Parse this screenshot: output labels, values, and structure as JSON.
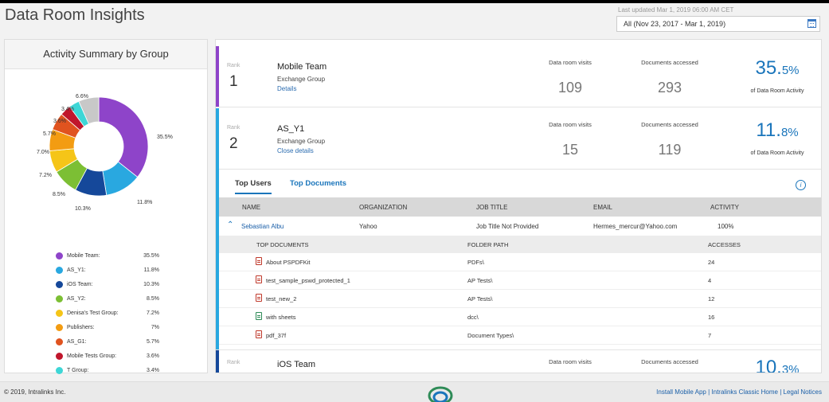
{
  "header": {
    "title": "Data Room Insights",
    "last_updated": "Last updated Mar 1, 2019 06:00 AM CET",
    "date_range": "All (Nov 23, 2017 - Mar 1, 2019)"
  },
  "activity_summary": {
    "title": "Activity Summary by Group",
    "slices": [
      {
        "label": "Mobile Team:",
        "value": "35.5%",
        "pct": 35.5,
        "color": "#8e44c9"
      },
      {
        "label": "AS_Y1:",
        "value": "11.8%",
        "pct": 11.8,
        "color": "#29a8e0"
      },
      {
        "label": "iOS Team:",
        "value": "10.3%",
        "pct": 10.3,
        "color": "#15489a"
      },
      {
        "label": "AS_Y2:",
        "value": "8.5%",
        "pct": 8.5,
        "color": "#7cbf34"
      },
      {
        "label": "Denisa's Test Group:",
        "value": "7.2%",
        "pct": 7.2,
        "color": "#f5c518"
      },
      {
        "label": "Publishers:",
        "value": "7%",
        "pct": 7.0,
        "color": "#f39c12"
      },
      {
        "label": "AS_G1:",
        "value": "5.7%",
        "pct": 5.7,
        "color": "#e0531f"
      },
      {
        "label": "Mobile Tests Group:",
        "value": "3.6%",
        "pct": 3.6,
        "color": "#c0162c"
      },
      {
        "label": "T Group:",
        "value": "3.4%",
        "pct": 3.4,
        "color": "#3ed6d6"
      },
      {
        "label": "",
        "value": "6.6%",
        "pct": 6.6,
        "color": "#c8c8c8"
      }
    ],
    "outer_labels": [
      "35.5%",
      "11.8%",
      "10.3%",
      "8.5%",
      "7.2%",
      "7.0%",
      "5.7%",
      "3.6%",
      "3.4%",
      "6.6%"
    ]
  },
  "cards": [
    {
      "rank_label": "Rank",
      "rank": "1",
      "name": "Mobile Team",
      "sub": "Exchange Group",
      "link": "Details",
      "visits_label": "Data room visits",
      "visits": "109",
      "docs_label": "Documents accessed",
      "docs": "293",
      "pct_main": "35.",
      "pct_small": "5%",
      "pct_label": "of Data Room Activity",
      "stripe": "#8e44c9"
    },
    {
      "rank_label": "Rank",
      "rank": "2",
      "name": "AS_Y1",
      "sub": "Exchange Group",
      "link": "Close details",
      "visits_label": "Data room visits",
      "visits": "15",
      "docs_label": "Documents accessed",
      "docs": "119",
      "pct_main": "11.",
      "pct_small": "8%",
      "pct_label": "of Data Room Activity",
      "stripe": "#29a8e0"
    },
    {
      "rank_label": "Rank",
      "name": "iOS Team",
      "visits_label": "Data room visits",
      "docs_label": "Documents accessed",
      "pct_main": "10.",
      "pct_small": "3%",
      "stripe": "#15489a"
    }
  ],
  "tabs": {
    "top_users": "Top Users",
    "top_documents": "Top Documents"
  },
  "users_table": {
    "headers": {
      "name": "NAME",
      "org": "ORGANIZATION",
      "job": "JOB TITLE",
      "email": "EMAIL",
      "activity": "ACTIVITY"
    },
    "row": {
      "name": "Sebastian Albu",
      "org": "Yahoo",
      "job": "Job Title Not Provided",
      "email": "Hermes_mercur@Yahoo.com",
      "activity": "100%"
    }
  },
  "docs_table": {
    "headers": {
      "doc": "TOP DOCUMENTS",
      "path": "FOLDER PATH",
      "accesses": "ACCESSES"
    },
    "rows": [
      {
        "name": "About PSPDFKit",
        "path": "PDFs\\",
        "accesses": "24",
        "icon": "pdf"
      },
      {
        "name": "test_sample_pswd_protected_1",
        "path": "AP Tests\\",
        "accesses": "4",
        "icon": "pdf"
      },
      {
        "name": "test_new_2",
        "path": "AP Tests\\",
        "accesses": "12",
        "icon": "pdf"
      },
      {
        "name": "with sheets",
        "path": "dcc\\",
        "accesses": "16",
        "icon": "xls"
      },
      {
        "name": "pdf_37f",
        "path": "Document Types\\",
        "accesses": "7",
        "icon": "pdf"
      }
    ]
  },
  "footer": {
    "copyright": "© 2019, Intralinks Inc.",
    "link1": "Install Mobile App",
    "link2": "Intralinks Classic Home",
    "link3": "Legal Notices",
    "sep": " | "
  }
}
